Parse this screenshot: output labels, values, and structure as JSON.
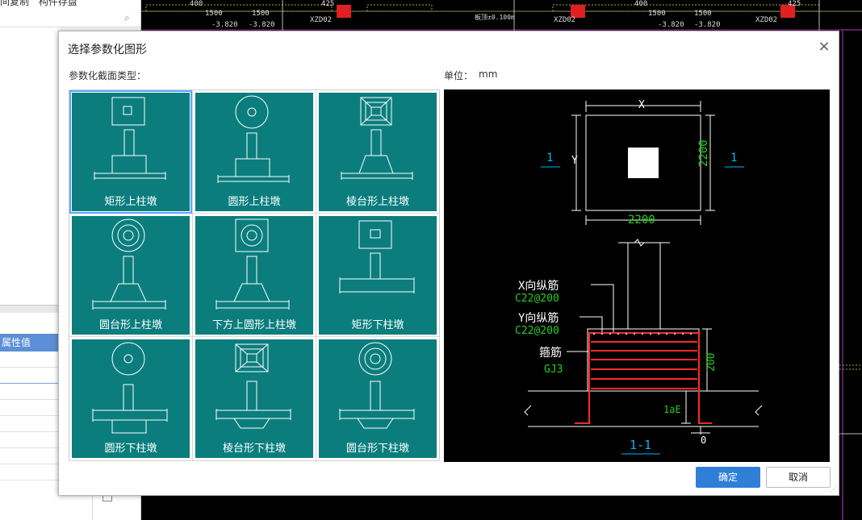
{
  "background": {
    "toolbar_items": [
      "间复制",
      "构件存盘"
    ],
    "property_header": "属性值",
    "cad_labels": [
      "400",
      "425",
      "1500",
      "1500",
      "-3.820",
      "-3.820",
      "XZD02",
      "板顶±0.100m",
      "XZD02",
      "400",
      "1500",
      "1500",
      "-3.820",
      "-3.820",
      "XZD02",
      "425"
    ]
  },
  "dialog": {
    "title": "选择参数化图形",
    "type_label": "参数化截面类型：",
    "unit_label": "单位：",
    "unit_value": "mm",
    "ok_label": "确定",
    "cancel_label": "取消"
  },
  "shapes": [
    {
      "label": "矩形上柱墩",
      "icon": "rect-upper-pier-icon",
      "selected": true
    },
    {
      "label": "圆形上柱墩",
      "icon": "circle-upper-pier-icon",
      "selected": false
    },
    {
      "label": "棱台形上柱墩",
      "icon": "frustum-upper-pier-icon",
      "selected": false
    },
    {
      "label": "圆台形上柱墩",
      "icon": "cone-upper-pier-icon",
      "selected": false
    },
    {
      "label": "下方上圆形上柱墩",
      "icon": "square-round-upper-pier-icon",
      "selected": false
    },
    {
      "label": "矩形下柱墩",
      "icon": "rect-lower-pier-icon",
      "selected": false
    },
    {
      "label": "圆形下柱墩",
      "icon": "circle-lower-pier-icon",
      "selected": false
    },
    {
      "label": "棱台形下柱墩",
      "icon": "frustum-lower-pier-icon",
      "selected": false
    },
    {
      "label": "圆台形下柱墩",
      "icon": "cone-lower-pier-icon",
      "selected": false
    }
  ],
  "preview": {
    "dim_x": "X",
    "dim_y": "Y",
    "width_value": "2200",
    "height_value": "2200",
    "section_mark": "1",
    "x_rebar_label": "X向纵筋",
    "x_rebar_value": "C22@200",
    "y_rebar_label": "Y向纵筋",
    "y_rebar_value": "C22@200",
    "stirrup_label": "箍筋",
    "stirrup_value": "GJ3",
    "depth_value": "200",
    "anchor_label": "1aE",
    "offset_value": "0",
    "section_title": "1-1",
    "colors": {
      "line": "#ffffff",
      "dim": "#23d01f",
      "mark": "#00b4ff",
      "rebar": "#ff2a2a"
    }
  }
}
